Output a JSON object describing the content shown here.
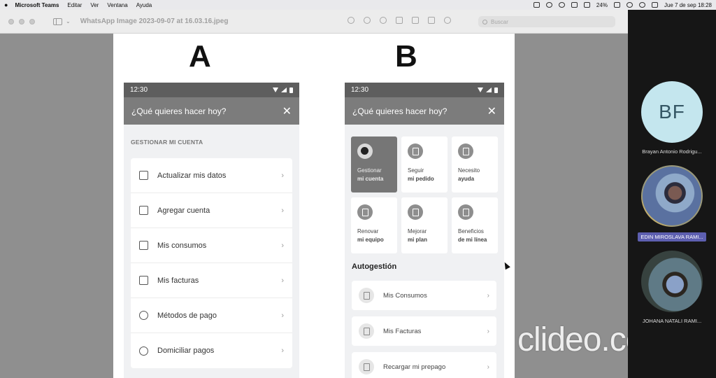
{
  "menubar": {
    "app": "Microsoft Teams",
    "menus": [
      "Editar",
      "Ver",
      "Ventana",
      "Ayuda"
    ],
    "battery": "24%",
    "datetime": "Jue 7 de sep  18:28"
  },
  "window": {
    "title": "WhatsApp Image 2023-09-07 at 16.03.16.jpeg",
    "search_placeholder": "Buscar"
  },
  "doc": {
    "label_a": "A",
    "label_b": "B",
    "phone_a": {
      "time": "12:30",
      "header": "¿Qué quieres hacer hoy?",
      "close": "✕",
      "section": "GESTIONAR MI CUENTA",
      "items": [
        {
          "label": "Actualizar mis datos",
          "icon": "user-edit-icon"
        },
        {
          "label": "Agregar cuenta",
          "icon": "sim-card-icon"
        },
        {
          "label": "Mis consumos",
          "icon": "document-icon"
        },
        {
          "label": "Mis facturas",
          "icon": "invoice-icon"
        },
        {
          "label": "Métodos de pago",
          "icon": "globe-icon"
        },
        {
          "label": "Domiciliar pagos",
          "icon": "globe-icon"
        }
      ]
    },
    "phone_b": {
      "time": "12:30",
      "header": "¿Qué quieres hacer hoy?",
      "close": "✕",
      "tiles": [
        {
          "line1": "Gestionar",
          "line2": "mi cuenta",
          "selected": true
        },
        {
          "line1": "Seguir",
          "line2": "mi pedido",
          "selected": false
        },
        {
          "line1": "Necesito",
          "line2": "ayuda",
          "selected": false
        },
        {
          "line1": "Renovar",
          "line2": "mi equipo",
          "selected": false
        },
        {
          "line1": "Mejorar",
          "line2": "mi plan",
          "selected": false
        },
        {
          "line1": "Beneficios",
          "line2": "de mi línea",
          "selected": false
        }
      ],
      "section": "Autogestión",
      "items": [
        {
          "label": "Mis Consumos"
        },
        {
          "label": "Mis Facturas"
        },
        {
          "label": "Recargar mi prepago"
        }
      ]
    }
  },
  "watermark": "clideo.com",
  "participants": [
    {
      "initials": "BF",
      "name": "Brayan Antonio Rodrigu..."
    },
    {
      "initials": "",
      "name": "EDIN MIROSLAVA RAMI..."
    },
    {
      "initials": "",
      "name": "JOHANA NATALI RAMI..."
    }
  ]
}
